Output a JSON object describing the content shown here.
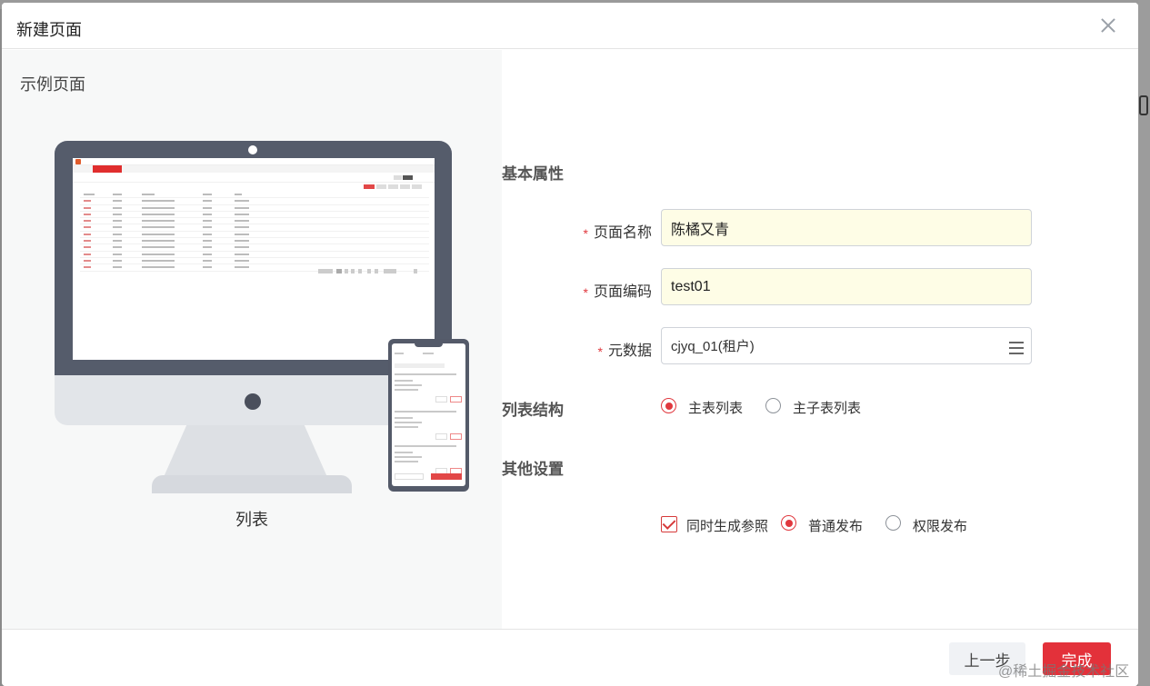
{
  "dialog": {
    "title": "新建页面",
    "close_icon": "close-icon"
  },
  "preview": {
    "title": "示例页面",
    "caption": "列表"
  },
  "form": {
    "basic_section": "基本属性",
    "page_name": {
      "label": "页面名称",
      "required": "*",
      "value": "陈橘又青"
    },
    "page_code": {
      "label": "页面编码",
      "required": "*",
      "value": "test01"
    },
    "metadata": {
      "label": "元数据",
      "required": "*",
      "value": "cjyq_01(租户)",
      "icon": "list-icon"
    },
    "list_structure": {
      "label": "列表结构",
      "options": [
        {
          "label": "主表列表",
          "selected": true
        },
        {
          "label": "主子表列表",
          "selected": false
        }
      ]
    },
    "other_section": "其他设置",
    "other": {
      "generate_ref": {
        "label": "同时生成参照",
        "checked": true
      },
      "publish_options": [
        {
          "label": "普通发布",
          "selected": true
        },
        {
          "label": "权限发布",
          "selected": false
        }
      ]
    }
  },
  "footer": {
    "prev_label": "上一步",
    "done_label": "完成"
  },
  "watermark": "@稀土掘金技术社区",
  "colors": {
    "accent": "#e3313a",
    "input_bg": "#fefde6"
  }
}
